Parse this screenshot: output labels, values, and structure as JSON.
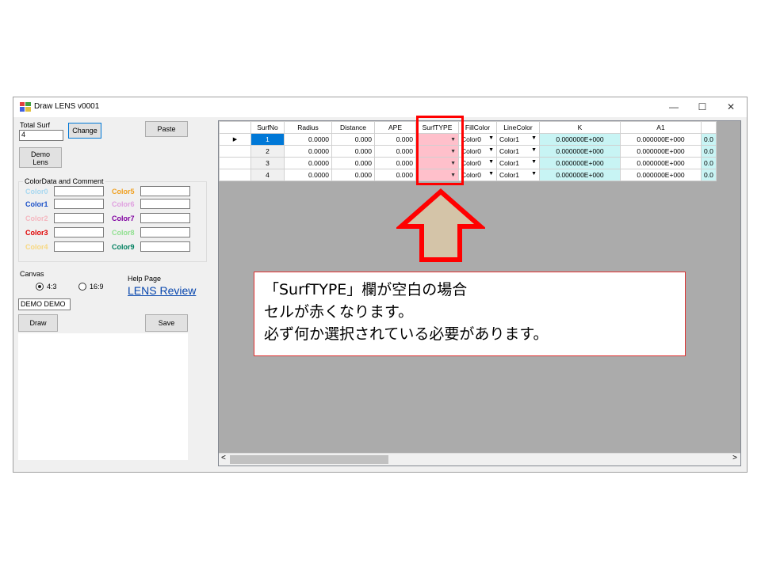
{
  "window": {
    "title": "Draw LENS v0001",
    "controls": [
      "—",
      "☐",
      "✕"
    ]
  },
  "left_panel": {
    "total_surf_label": "Total Surf",
    "total_surf_value": "4",
    "change_button": "Change",
    "paste_button": "Paste",
    "demo_lens_button_line1": "Demo",
    "demo_lens_button_line2": "Lens",
    "color_group_title": "ColorData and Comment",
    "colors": [
      {
        "label": "Color0",
        "color": "#a8d8f0"
      },
      {
        "label": "Color1",
        "color": "#1a50c8"
      },
      {
        "label": "Color2",
        "color": "#f4b8c0"
      },
      {
        "label": "Color3",
        "color": "#e00000"
      },
      {
        "label": "Color4",
        "color": "#f8d880"
      },
      {
        "label": "Color5",
        "color": "#f0a020"
      },
      {
        "label": "Color6",
        "color": "#e0a0e0"
      },
      {
        "label": "Color7",
        "color": "#8000a0"
      },
      {
        "label": "Color8",
        "color": "#90e090"
      },
      {
        "label": "Color9",
        "color": "#008060"
      }
    ],
    "canvas_label": "Canvas",
    "canvas_option_1": "4:3",
    "canvas_option_2": "16:9",
    "canvas_selected": "4:3",
    "help_page_label": "Help Page",
    "help_link": "LENS Review",
    "demo_text": "DEMO DEMO",
    "draw_button": "Draw",
    "save_button": "Save"
  },
  "grid": {
    "columns": [
      "SurfNo",
      "Radius",
      "Distance",
      "APE",
      "SurfTYPE",
      "FillColor",
      "LineColor",
      "K",
      "A1"
    ],
    "rows": [
      {
        "surf": "1",
        "radius": "0.0000",
        "distance": "0.000",
        "ape": "0.000",
        "surftype": "",
        "fill": "Color0",
        "line": "Color1",
        "k": "0.000000E+000",
        "a1": "0.000000E+000",
        "a2": "0.0"
      },
      {
        "surf": "2",
        "radius": "0.0000",
        "distance": "0.000",
        "ape": "0.000",
        "surftype": "",
        "fill": "Color0",
        "line": "Color1",
        "k": "0.000000E+000",
        "a1": "0.000000E+000",
        "a2": "0.0"
      },
      {
        "surf": "3",
        "radius": "0.0000",
        "distance": "0.000",
        "ape": "0.000",
        "surftype": "",
        "fill": "Color0",
        "line": "Color1",
        "k": "0.000000E+000",
        "a1": "0.000000E+000",
        "a2": "0.0"
      },
      {
        "surf": "4",
        "radius": "0.0000",
        "distance": "0.000",
        "ape": "0.000",
        "surftype": "",
        "fill": "Color0",
        "line": "Color1",
        "k": "0.000000E+000",
        "a1": "0.000000E+000",
        "a2": "0.0"
      }
    ]
  },
  "annotation": {
    "line1": "「SurfTYPE」欄が空白の場合",
    "line2": "セルが赤くなります。",
    "line3": "必ず何か選択されている必要があります。",
    "highlight_color": "#ff0000",
    "arrow_fill": "#d4c4a8"
  }
}
